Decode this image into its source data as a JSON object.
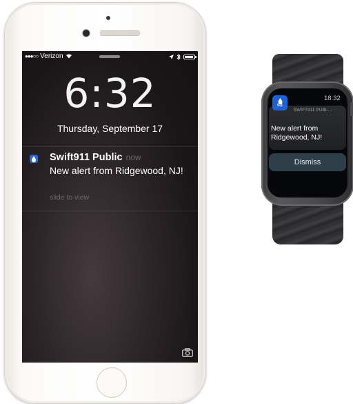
{
  "phone": {
    "status_bar": {
      "signal_dots": "●●●○○",
      "carrier": "Verizon",
      "wifi_icon": "wifi-icon",
      "location_icon": "location-arrow-icon",
      "bluetooth_icon": "bluetooth-icon",
      "battery_icon": "battery-icon"
    },
    "lock_screen": {
      "time": "6:32",
      "date": "Thursday, September 17"
    },
    "notification": {
      "app_name": "Swift911 Public",
      "time": "now",
      "message": "New alert from Ridgewood, NJ!",
      "hint": "slide to view",
      "app_icon": "swift911-app-icon"
    },
    "camera_shortcut_icon": "camera-icon"
  },
  "watch": {
    "time": "18:32",
    "app_name": "SWIFT911 PUBL...",
    "app_icon_label": "911",
    "message": "New alert from Ridgewood, NJ!",
    "dismiss_label": "Dismiss"
  },
  "colors": {
    "app_icon_blue": "#1e62d9",
    "dismiss_button": "#2f3f4a"
  }
}
